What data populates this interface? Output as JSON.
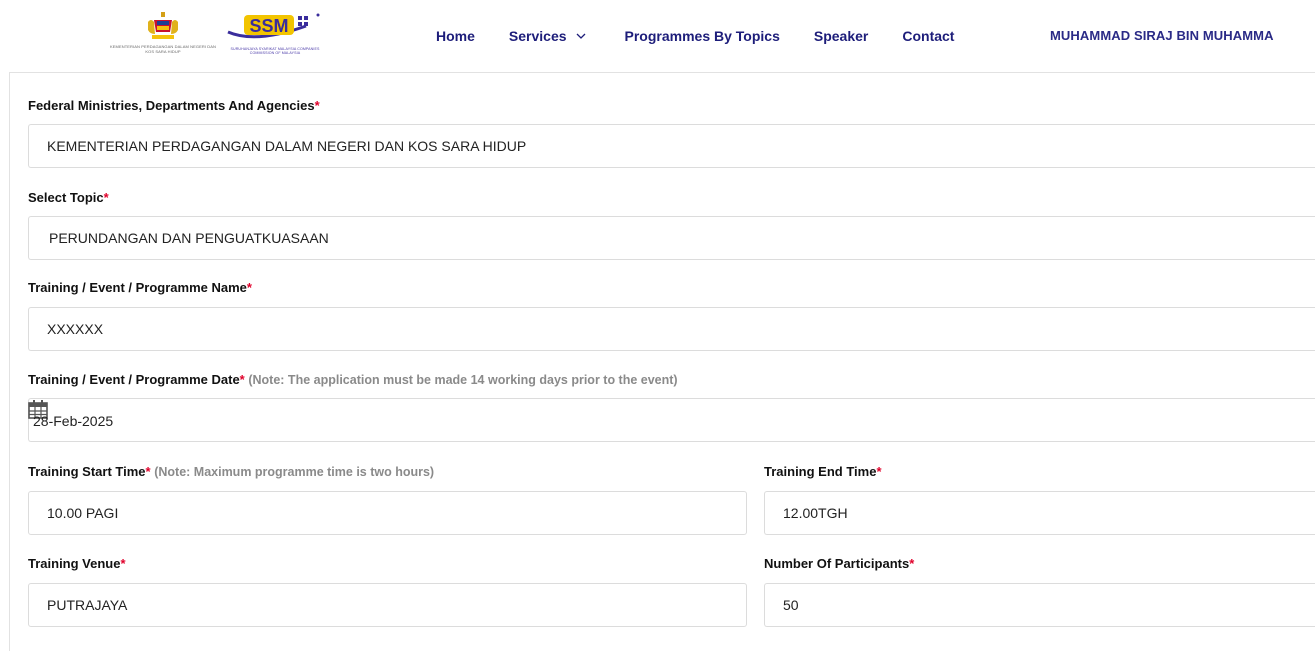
{
  "header": {
    "gov_logo_caption": "KEMENTERIAN PERDAGANGAN DALAM NEGERI DAN KOS SARA HIDUP",
    "ssm_logo_text": "SSM",
    "ssm_logo_caption": "SURUHANJAYA SYARIKAT MALAYSIA COMPANIES COMMISSION OF MALAYSIA",
    "nav": {
      "home": "Home",
      "services": "Services",
      "programmes": "Programmes By Topics",
      "speaker": "Speaker",
      "contact": "Contact"
    },
    "user_name": "MUHAMMAD SIRAJ BIN MUHAMMA"
  },
  "form": {
    "ministry": {
      "label": "Federal Ministries, Departments And Agencies",
      "required": "*",
      "value": "KEMENTERIAN PERDAGANGAN DALAM NEGERI DAN KOS SARA HIDUP"
    },
    "topic": {
      "label": "Select Topic",
      "required": "*",
      "value": "PERUNDANGAN DAN PENGUATKUASAAN"
    },
    "program_name": {
      "label": "Training / Event / Programme Name",
      "required": "*",
      "value": "XXXXXX"
    },
    "program_date": {
      "label": "Training / Event / Programme Date",
      "required": "*",
      "note": "(Note: The application must be made 14 working days prior to the event)",
      "value": "28-Feb-2025"
    },
    "start_time": {
      "label": "Training Start Time",
      "required": "*",
      "note": "(Note: Maximum programme time is two hours)",
      "value": "10.00 PAGI"
    },
    "end_time": {
      "label": "Training End Time",
      "required": "*",
      "value": "12.00TGH"
    },
    "venue": {
      "label": "Training Venue",
      "required": "*",
      "value": "PUTRAJAYA"
    },
    "participants": {
      "label": "Number Of Participants",
      "required": "*",
      "value": "50"
    }
  },
  "colors": {
    "nav_text": "#1d1d7a",
    "required": "#e0002a",
    "note": "#8a8a8a",
    "border": "#dcdcdc"
  },
  "icons": {
    "crest": "malaysia-crest-icon",
    "chevron": "chevron-down-icon",
    "calendar": "calendar-icon"
  }
}
